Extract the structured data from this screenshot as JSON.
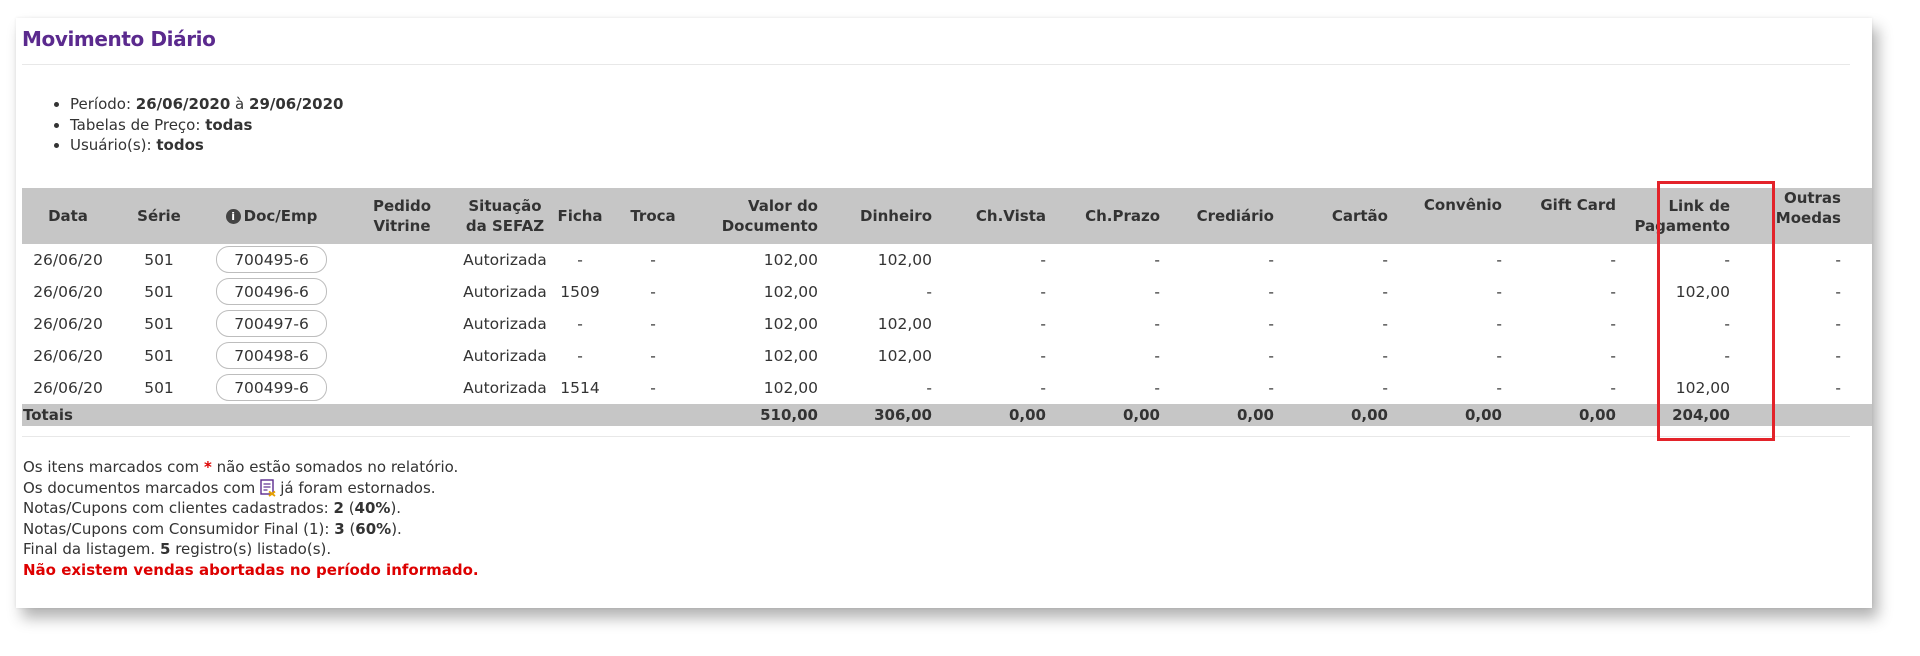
{
  "page_title": "Movimento Diário",
  "filters": {
    "periodo_label": "Período:",
    "periodo_start": "26/06/2020",
    "periodo_sep": "à",
    "periodo_end": "29/06/2020",
    "tabelas_label": "Tabelas de Preço:",
    "tabelas_value": "todas",
    "usuarios_label": "Usuário(s):",
    "usuarios_value": "todos"
  },
  "table": {
    "headers": {
      "data": "Data",
      "serie": "Série",
      "doc_emp": "Doc/Emp",
      "pedido_vitrine": "Pedido Vitrine",
      "situacao_1": "Situação",
      "situacao_2": "da SEFAZ",
      "ficha": "Ficha",
      "troca": "Troca",
      "valor_1": "Valor do",
      "valor_2": "Documento",
      "dinheiro": "Dinheiro",
      "ch_vista": "Ch.Vista",
      "ch_prazo": "Ch.Prazo",
      "crediario": "Crediário",
      "cartao": "Cartão",
      "convenio": "Convênio",
      "gift_card": "Gift Card",
      "link_1": "Link de",
      "link_2": "Pagamento",
      "outras_1": "Outras",
      "outras_2": "Moedas"
    },
    "rows": [
      {
        "data": "26/06/20",
        "serie": "501",
        "doc": "700495-6",
        "pedido": "",
        "situacao": "Autorizada",
        "ficha": "-",
        "troca": "-",
        "valor": "102,00",
        "dinheiro": "102,00",
        "ch_vista": "-",
        "ch_prazo": "-",
        "crediario": "-",
        "cartao": "-",
        "convenio": "-",
        "gift_card": "-",
        "link": "-",
        "outras": "-"
      },
      {
        "data": "26/06/20",
        "serie": "501",
        "doc": "700496-6",
        "pedido": "",
        "situacao": "Autorizada",
        "ficha": "1509",
        "troca": "-",
        "valor": "102,00",
        "dinheiro": "-",
        "ch_vista": "-",
        "ch_prazo": "-",
        "crediario": "-",
        "cartao": "-",
        "convenio": "-",
        "gift_card": "-",
        "link": "102,00",
        "outras": "-"
      },
      {
        "data": "26/06/20",
        "serie": "501",
        "doc": "700497-6",
        "pedido": "",
        "situacao": "Autorizada",
        "ficha": "-",
        "troca": "-",
        "valor": "102,00",
        "dinheiro": "102,00",
        "ch_vista": "-",
        "ch_prazo": "-",
        "crediario": "-",
        "cartao": "-",
        "convenio": "-",
        "gift_card": "-",
        "link": "-",
        "outras": "-"
      },
      {
        "data": "26/06/20",
        "serie": "501",
        "doc": "700498-6",
        "pedido": "",
        "situacao": "Autorizada",
        "ficha": "-",
        "troca": "-",
        "valor": "102,00",
        "dinheiro": "102,00",
        "ch_vista": "-",
        "ch_prazo": "-",
        "crediario": "-",
        "cartao": "-",
        "convenio": "-",
        "gift_card": "-",
        "link": "-",
        "outras": "-"
      },
      {
        "data": "26/06/20",
        "serie": "501",
        "doc": "700499-6",
        "pedido": "",
        "situacao": "Autorizada",
        "ficha": "1514",
        "troca": "-",
        "valor": "102,00",
        "dinheiro": "-",
        "ch_vista": "-",
        "ch_prazo": "-",
        "crediario": "-",
        "cartao": "-",
        "convenio": "-",
        "gift_card": "-",
        "link": "102,00",
        "outras": "-"
      }
    ],
    "totals": {
      "label": "Totais",
      "valor": "510,00",
      "dinheiro": "306,00",
      "ch_vista": "0,00",
      "ch_prazo": "0,00",
      "crediario": "0,00",
      "cartao": "0,00",
      "convenio": "0,00",
      "gift_card": "0,00",
      "link": "204,00"
    }
  },
  "notes": {
    "line1_a": "Os itens marcados com",
    "line1_star": "*",
    "line1_b": "não estão somados no relatório.",
    "line2_a": "Os documentos marcados com",
    "line2_b": "já foram estornados.",
    "line3_label": "Notas/Cupons com clientes cadastrados:",
    "line3_count": "2",
    "line3_pct": "40%",
    "line4_label": "Notas/Cupons com Consumidor Final (1):",
    "line4_count": "3",
    "line4_pct": "60%",
    "line5_a": "Final da listagem.",
    "line5_count": "5",
    "line5_b": "registro(s) listado(s).",
    "warning": "Não existem vendas abortadas no período informado."
  },
  "colors": {
    "title": "#5b2a8e",
    "header_bg": "#c6c6c6",
    "warning": "#dd0000",
    "highlight": "#e3232a"
  },
  "icons": {
    "info": "info-circle-icon",
    "estorno": "document-reversed-icon"
  }
}
